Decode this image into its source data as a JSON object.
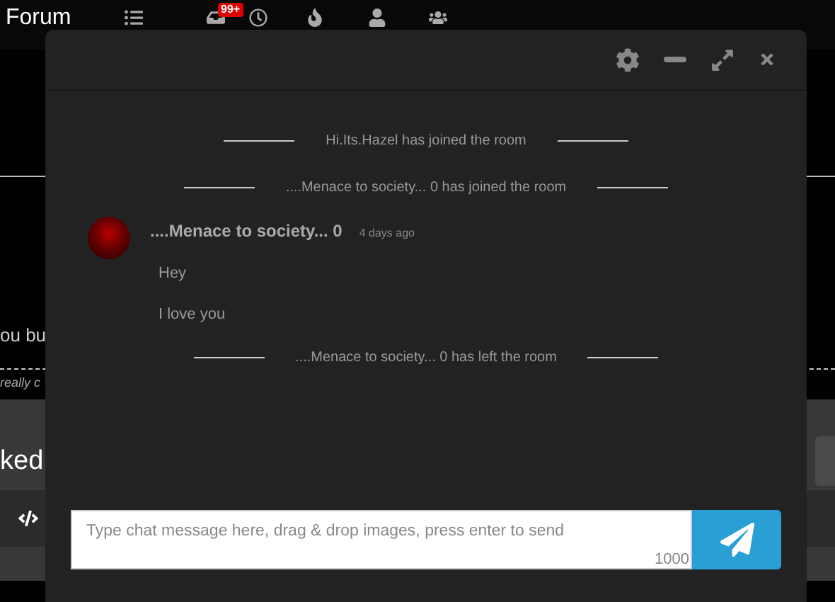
{
  "nav": {
    "brand": "Forum",
    "badge": "99+"
  },
  "background": {
    "fragment_1": "ou bu",
    "fragment_2": "really c",
    "heading_fragment": "ked"
  },
  "chat": {
    "messages": [
      {
        "kind": "system",
        "text": "Hi.Its.Hazel has joined the room"
      },
      {
        "kind": "system",
        "text": "....Menace to society... 0 has joined the room"
      },
      {
        "kind": "user",
        "author": "....Menace to society... 0",
        "time": "4 days ago",
        "lines": [
          "Hey",
          "I love you"
        ]
      },
      {
        "kind": "system",
        "text": "....Menace to society... 0 has left the room"
      }
    ],
    "input": {
      "placeholder": "Type chat message here, drag & drop images, press enter to send",
      "counter": "1000"
    }
  }
}
